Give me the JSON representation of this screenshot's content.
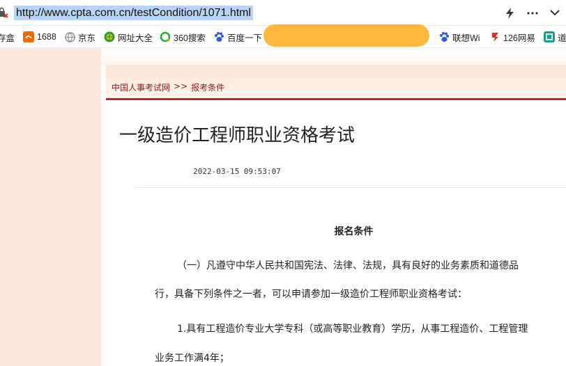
{
  "address_bar": {
    "url": "http://www.cpta.com.cn/testCondition/1071.html",
    "site_icon": "security-warning-icon",
    "actions": [
      "lightning-icon",
      "more-icon",
      "chevron-down-icon"
    ]
  },
  "bookmarks": [
    {
      "label": "存盒",
      "icon": "bookmark-icon"
    },
    {
      "label": "1688",
      "icon": "1688-icon"
    },
    {
      "label": "京东",
      "icon": "globe-icon"
    },
    {
      "label": "网址大全",
      "icon": "hao-icon"
    },
    {
      "label": "360搜索",
      "icon": "360-search-icon"
    },
    {
      "label": "百度一下",
      "icon": "baidu-paw-icon"
    },
    {
      "label": "联想Wi",
      "icon": "baidu-paw-icon"
    },
    {
      "label": "126网易",
      "icon": "netease-icon"
    },
    {
      "label": "道",
      "icon": "dao-icon"
    }
  ],
  "page": {
    "breadcrumb": {
      "home": "中国人事考试网",
      "separator": ">>",
      "current": "报考条件"
    },
    "title": "一级造价工程师职业资格考试",
    "date": "2022-03-15  09:53:07",
    "section_title": "报名条件",
    "paragraphs": [
      "（一）凡遵守中华人民共和国宪法、法律、法规，具有良好的业务素质和道德品",
      "行，具备下列条件之一者，可以申请参加一级造价工程师职业资格考试：",
      "1.具有工程造价专业大学专科（或高等职业教育）学历，从事工程造价、工程管理",
      "业务工作满4年；"
    ]
  },
  "colors": {
    "accent_red": "#c0272d",
    "highlight_orange": "#fdb73c",
    "sidebar_peach": "#fde9db",
    "url_selection": "#b7d4f5"
  }
}
